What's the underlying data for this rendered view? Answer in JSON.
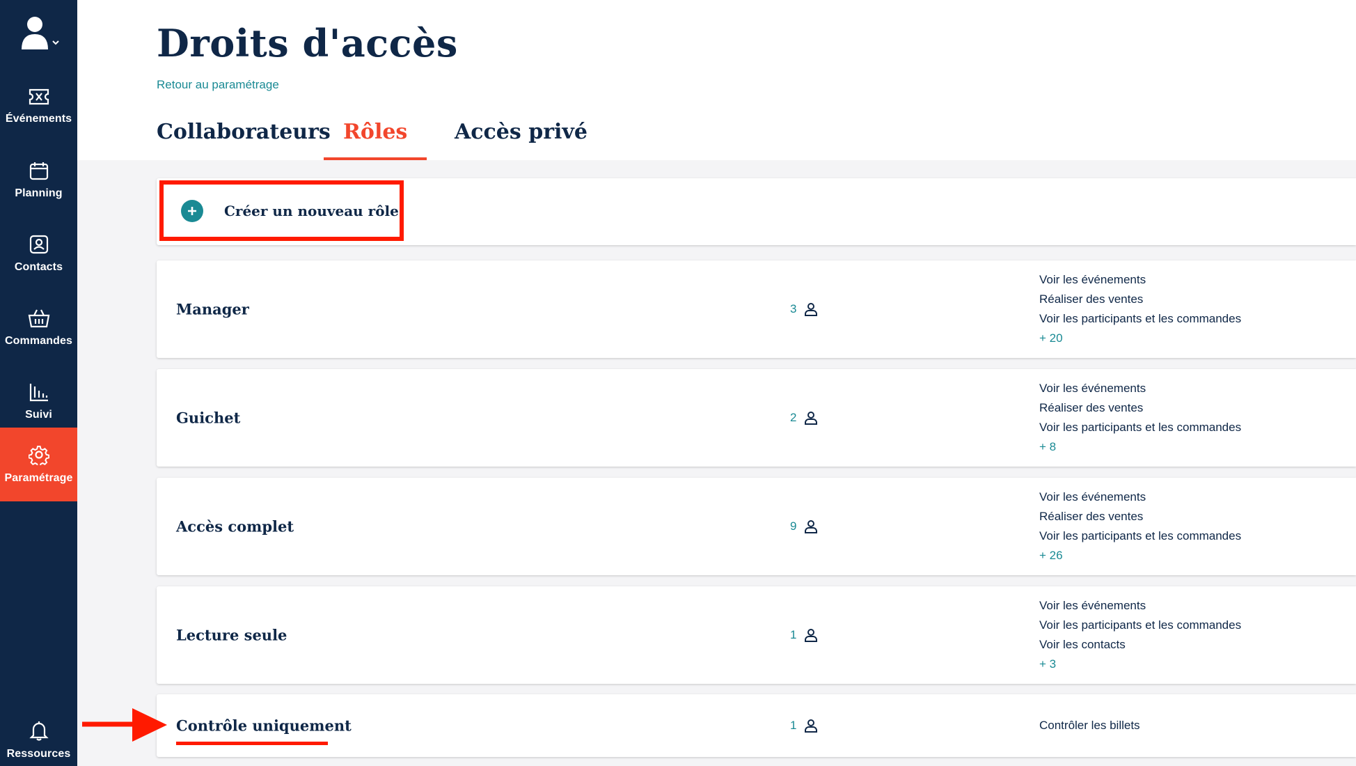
{
  "sidebar": {
    "items": [
      {
        "label": "Événements",
        "icon": "ticket-icon"
      },
      {
        "label": "Planning",
        "icon": "calendar-icon"
      },
      {
        "label": "Contacts",
        "icon": "contact-icon"
      },
      {
        "label": "Commandes",
        "icon": "basket-icon"
      },
      {
        "label": "Suivi",
        "icon": "chart-icon"
      },
      {
        "label": "Paramétrage",
        "icon": "gear-icon",
        "active": true
      }
    ],
    "bottom_item": {
      "label": "Ressources",
      "icon": "bell-icon"
    }
  },
  "header": {
    "title": "Droits d'accès",
    "back_link": "Retour au paramétrage",
    "tabs": [
      {
        "label": "Collaborateurs"
      },
      {
        "label": "Rôles",
        "active": true
      },
      {
        "label": "Accès privé"
      }
    ]
  },
  "create_role": {
    "label": "Créer un nouveau rôle"
  },
  "roles": [
    {
      "name": "Manager",
      "count": "3",
      "permissions": [
        "Voir les événements",
        "Réaliser des ventes",
        "Voir les participants et les commandes"
      ],
      "more": "+ 20"
    },
    {
      "name": "Guichet",
      "count": "2",
      "permissions": [
        "Voir les événements",
        "Réaliser des ventes",
        "Voir les participants et les commandes"
      ],
      "more": "+ 8"
    },
    {
      "name": "Accès complet",
      "count": "9",
      "permissions": [
        "Voir les événements",
        "Réaliser des ventes",
        "Voir les participants et les commandes"
      ],
      "more": "+ 26"
    },
    {
      "name": "Lecture seule",
      "count": "1",
      "permissions": [
        "Voir les événements",
        "Voir les participants et les commandes",
        "Voir les contacts"
      ],
      "more": "+ 3"
    },
    {
      "name": "Contrôle uniquement",
      "count": "1",
      "permissions": [
        "Contrôler les billets"
      ]
    }
  ],
  "colors": {
    "sidebar": "#0f2747",
    "accent": "#f2462c",
    "teal": "#1a8a94",
    "highlight_red": "#ff1a00"
  }
}
